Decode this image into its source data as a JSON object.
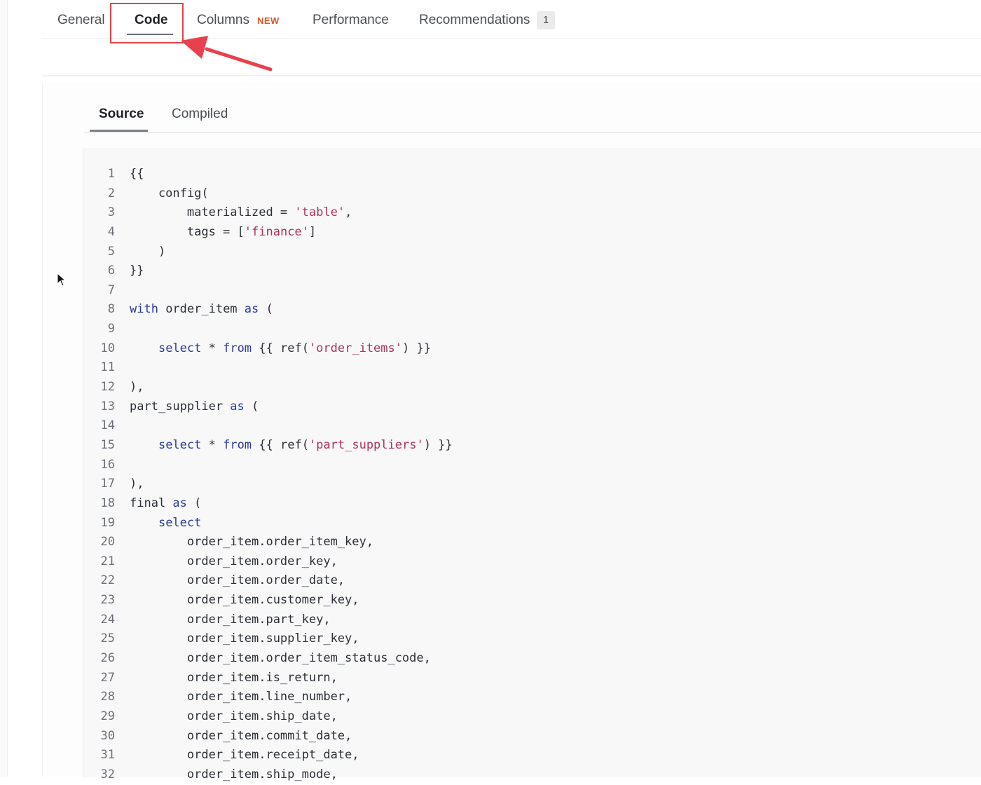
{
  "tabs": {
    "general": "General",
    "code": "Code",
    "columns": "Columns",
    "columns_badge": "NEW",
    "performance": "Performance",
    "recommendations": "Recommendations",
    "recommendations_count": "1",
    "active": "Code"
  },
  "subtabs": {
    "source": "Source",
    "compiled": "Compiled",
    "active": "Source"
  },
  "annotation": {
    "color": "#e8414b"
  },
  "colors": {
    "keyword": "#2b3a9a",
    "string": "#b0325a",
    "text": "#2c3038"
  },
  "code": {
    "lines": [
      [
        [
          "{{",
          ""
        ]
      ],
      [
        [
          "    config(",
          ""
        ]
      ],
      [
        [
          "        materialized = ",
          ""
        ],
        [
          "'table'",
          "str"
        ],
        [
          ",",
          ""
        ]
      ],
      [
        [
          "        tags = [",
          ""
        ],
        [
          "'finance'",
          "str"
        ],
        [
          "]",
          ""
        ]
      ],
      [
        [
          "    )",
          ""
        ]
      ],
      [
        [
          "}}",
          ""
        ]
      ],
      [],
      [
        [
          "with",
          "kw"
        ],
        [
          " order_item ",
          ""
        ],
        [
          "as",
          "kw"
        ],
        [
          " (",
          ""
        ]
      ],
      [],
      [
        [
          "    ",
          ""
        ],
        [
          "select",
          "kw"
        ],
        [
          " * ",
          ""
        ],
        [
          "from",
          "kw"
        ],
        [
          " {{ ref(",
          ""
        ],
        [
          "'order_items'",
          "str"
        ],
        [
          ") }}",
          ""
        ]
      ],
      [],
      [
        [
          "),",
          ""
        ]
      ],
      [
        [
          "part_supplier ",
          ""
        ],
        [
          "as",
          "kw"
        ],
        [
          " (",
          ""
        ]
      ],
      [],
      [
        [
          "    ",
          ""
        ],
        [
          "select",
          "kw"
        ],
        [
          " * ",
          ""
        ],
        [
          "from",
          "kw"
        ],
        [
          " {{ ref(",
          ""
        ],
        [
          "'part_suppliers'",
          "str"
        ],
        [
          ") }}",
          ""
        ]
      ],
      [],
      [
        [
          "),",
          ""
        ]
      ],
      [
        [
          "final ",
          ""
        ],
        [
          "as",
          "kw"
        ],
        [
          " (",
          ""
        ]
      ],
      [
        [
          "    ",
          ""
        ],
        [
          "select",
          "kw"
        ]
      ],
      [
        [
          "        order_item.order_item_key,",
          ""
        ]
      ],
      [
        [
          "        order_item.order_key,",
          ""
        ]
      ],
      [
        [
          "        order_item.order_date,",
          ""
        ]
      ],
      [
        [
          "        order_item.customer_key,",
          ""
        ]
      ],
      [
        [
          "        order_item.part_key,",
          ""
        ]
      ],
      [
        [
          "        order_item.supplier_key,",
          ""
        ]
      ],
      [
        [
          "        order_item.order_item_status_code,",
          ""
        ]
      ],
      [
        [
          "        order_item.is_return,",
          ""
        ]
      ],
      [
        [
          "        order_item.line_number,",
          ""
        ]
      ],
      [
        [
          "        order_item.ship_date,",
          ""
        ]
      ],
      [
        [
          "        order_item.commit_date,",
          ""
        ]
      ],
      [
        [
          "        order_item.receipt_date,",
          ""
        ]
      ],
      [
        [
          "        order_item.ship_mode,",
          ""
        ]
      ]
    ]
  }
}
